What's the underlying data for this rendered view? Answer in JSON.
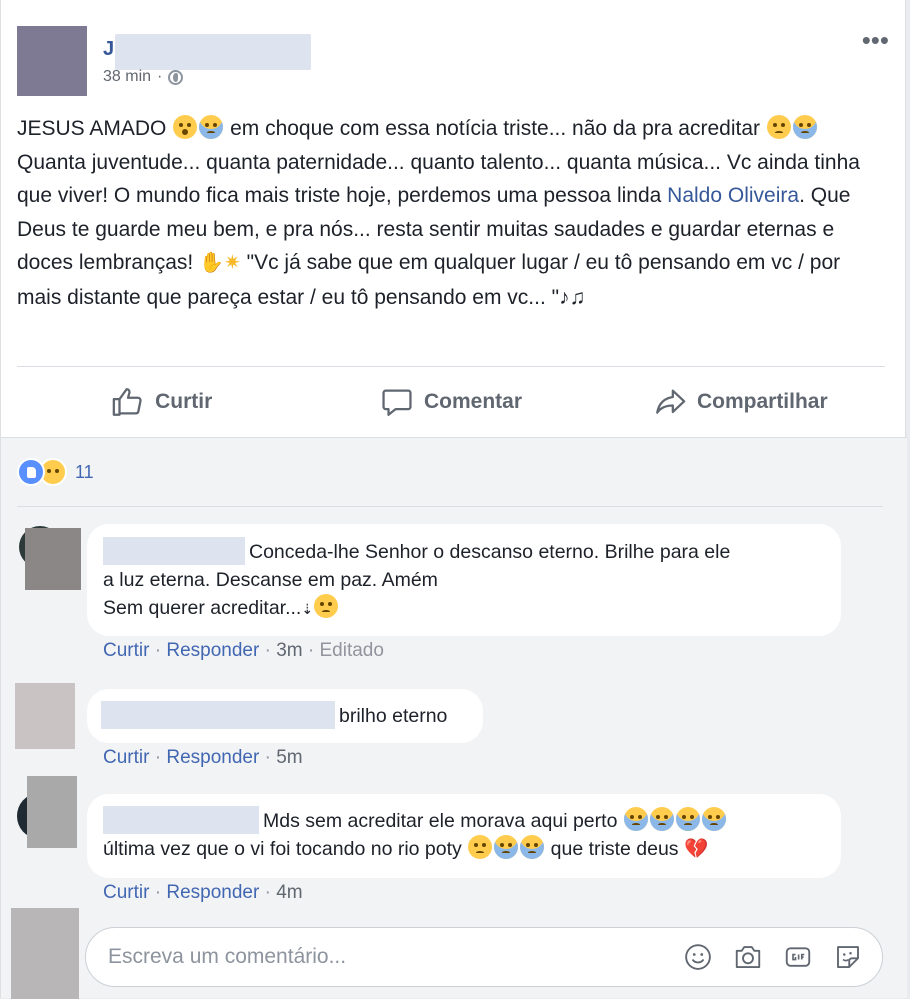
{
  "post": {
    "author_initial": "J",
    "time": "38 min",
    "meta_separator": "·",
    "more_label": "•••",
    "text": {
      "p1": "JESUS AMADO",
      "p2": "em choque com essa notícia triste... não da pra acreditar",
      "p3": "Quanta juventude... quanta paternidade... quanto talento... quanta música... Vc ainda tinha que viver! O mundo fica mais triste hoje, perdemos uma pessoa linda",
      "link": "Naldo Oliveira",
      "p4": ". Que Deus te guarde meu bem, e pra nós... resta sentir muitas saudades e guardar eternas e doces lembranças!",
      "p5": "\"Vc já sabe que em qualquer lugar / eu tô pensando em vc / por mais distante que pareça estar / eu tô pensando em vc... \"",
      "music": "♪♫"
    },
    "actions": {
      "like": "Curtir",
      "comment": "Comentar",
      "share": "Compartilhar"
    }
  },
  "reactions": {
    "count": "11"
  },
  "comments": [
    {
      "line1": "Conceda-lhe Senhor o descanso eterno. Brilhe para ele",
      "line2": "a luz eterna. Descanse em paz. Amém",
      "line3": "Sem querer acreditar...",
      "like": "Curtir",
      "reply": "Responder",
      "time": "3m",
      "edited": "Editado",
      "sep": "·"
    },
    {
      "line1": "brilho eterno",
      "like": "Curtir",
      "reply": "Responder",
      "time": "5m",
      "sep": "·"
    },
    {
      "line1": "Mds sem acreditar ele morava aqui perto",
      "line2a": "última vez que o vi foi tocando no rio poty",
      "line2b": "que triste deus",
      "heart": "💔",
      "like": "Curtir",
      "reply": "Responder",
      "time": "4m",
      "sep": "·"
    }
  ],
  "composer": {
    "placeholder": "Escreva um comentário..."
  },
  "colors": {
    "link": "#365899",
    "action_link": "#4267b2",
    "muted": "#90949c",
    "bg": "#f2f3f5"
  }
}
